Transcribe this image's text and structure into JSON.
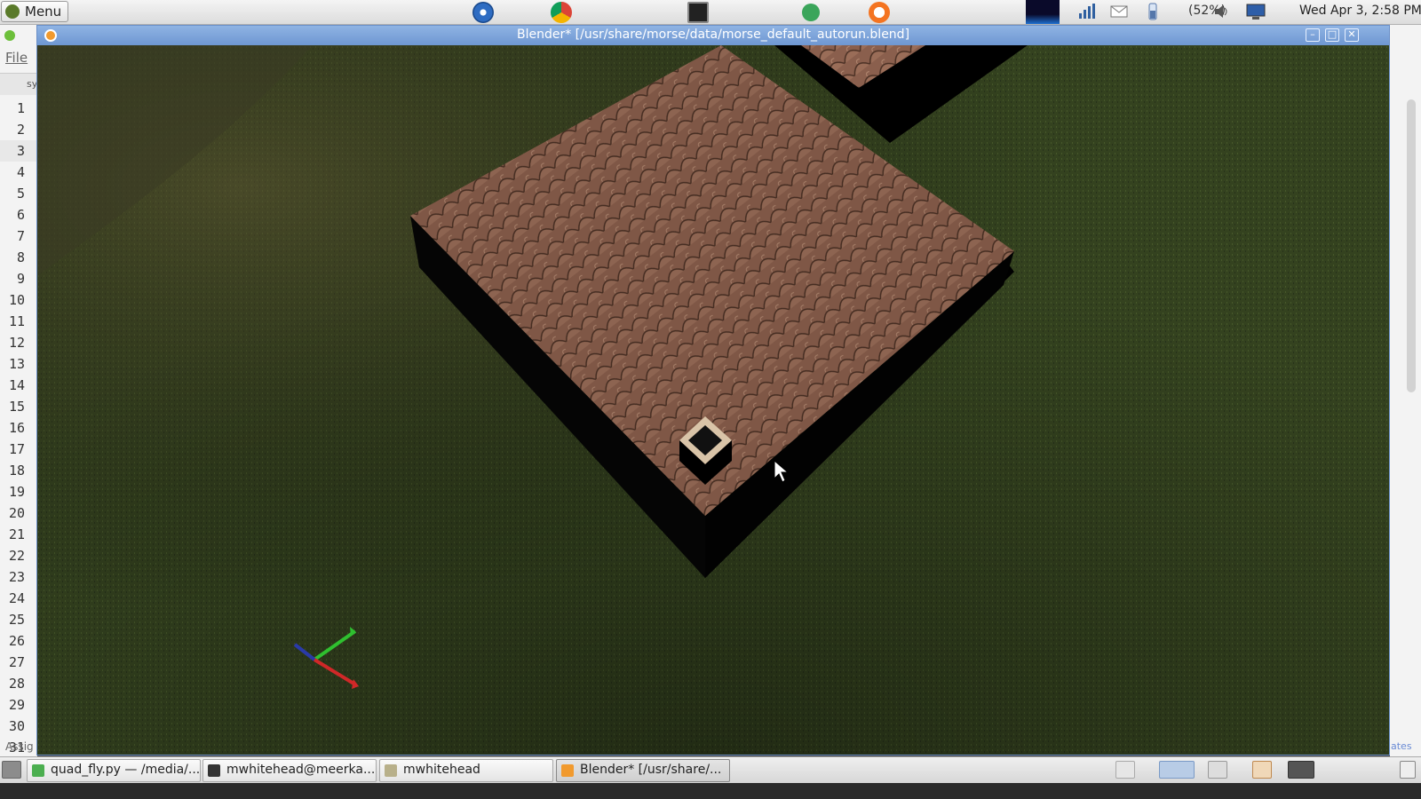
{
  "top_panel": {
    "menu_label": "Menu",
    "battery": "(52%)",
    "clock": "Wed Apr  3,  2:58 PM"
  },
  "editor": {
    "file_menu": "File",
    "tab_stub": "sy",
    "line_numbers": [
      "1",
      "2",
      "3",
      "4",
      "5",
      "6",
      "7",
      "8",
      "9",
      "10",
      "11",
      "12",
      "13",
      "14",
      "15",
      "16",
      "17",
      "18",
      "19",
      "20",
      "21",
      "22",
      "23",
      "24",
      "25",
      "26",
      "27",
      "28",
      "29",
      "30",
      "31"
    ],
    "highlight_line": "3",
    "status_stub": "Assig",
    "right_stub": "ates"
  },
  "blender_window": {
    "title": "Blender* [/usr/share/morse/data/morse_default_autorun.blend]",
    "min_glyph": "–",
    "max_glyph": "□",
    "close_glyph": "✕"
  },
  "taskbar": {
    "tasks": [
      {
        "label": "quad_fly.py — /media/...",
        "icon_color": "#4caf50"
      },
      {
        "label": "mwhitehead@meerka...",
        "icon_color": "#333333"
      },
      {
        "label": "mwhitehead",
        "icon_color": "#b8b08a"
      },
      {
        "label": "Blender* [/usr/share/...",
        "icon_color": "#f19a2e"
      }
    ]
  },
  "colors": {
    "title_bar": "#7aa3dc",
    "grass": "#2f3a1f",
    "roof": "#8a5f4d",
    "axis_x": "#d02828",
    "axis_y": "#2fc02f",
    "axis_z": "#2a3aa8"
  }
}
